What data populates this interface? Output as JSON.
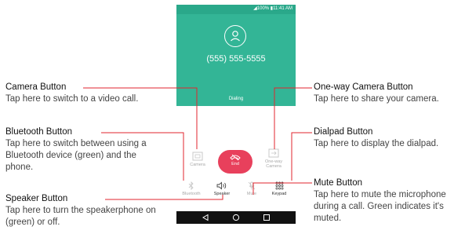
{
  "phone": {
    "status_text": "◢100% ▮11:41 AM",
    "phone_number": "(555) 555-5555",
    "call_status": "Dialing",
    "buttons": {
      "camera": "Camera",
      "end": "End",
      "oneway_line1": "One-way",
      "oneway_line2": "Camera",
      "bluetooth": "Bluetooth",
      "speaker": "Speaker",
      "mute": "Mute",
      "keypad": "Keypad"
    },
    "colors": {
      "teal": "#33b596",
      "status_teal": "#2aa88a",
      "end_red": "#e8405c",
      "callout_red": "#e0262f"
    }
  },
  "callouts": {
    "camera": {
      "title": "Camera Button",
      "desc": "Tap here to switch to a video call."
    },
    "bluetooth": {
      "title": "Bluetooth Button",
      "desc": "Tap here to switch between using a Bluetooth device (green) and the phone."
    },
    "speaker": {
      "title": "Speaker Button",
      "desc": "Tap here to turn the speakerphone on (green) or off."
    },
    "oneway": {
      "title": "One-way Camera Button",
      "desc": "Tap here to share your camera."
    },
    "dialpad": {
      "title": "Dialpad Button",
      "desc": "Tap here to display the dialpad."
    },
    "mute": {
      "title": "Mute Button",
      "desc": "Tap here to mute the microphone during a call. Green indicates it's muted."
    }
  },
  "icons": [
    "person-icon",
    "camera-icon",
    "end-call-icon",
    "oneway-camera-icon",
    "bluetooth-icon",
    "speaker-icon",
    "mute-icon",
    "keypad-icon",
    "back-icon",
    "home-icon",
    "recents-icon"
  ]
}
